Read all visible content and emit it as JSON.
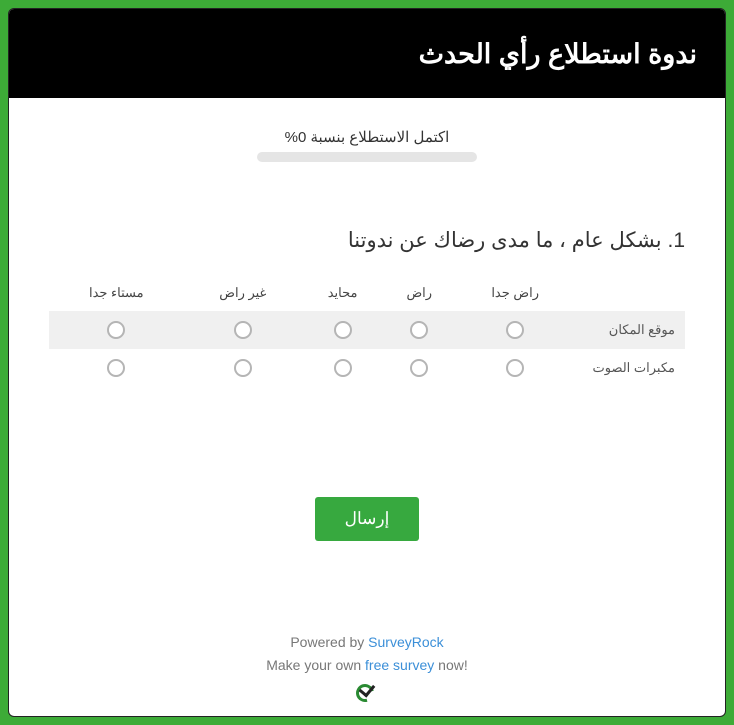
{
  "header": {
    "title": "ندوة استطلاع رأي الحدث"
  },
  "progress": {
    "text": "اكتمل الاستطلاع بنسبة 0%"
  },
  "question": {
    "title": "1. بشكل عام ، ما مدى رضاك عن ندوتنا",
    "scale": [
      "راض جدا",
      "راض",
      "محايد",
      "غير راض",
      "مستاء جدا"
    ],
    "rows": [
      "موقع المكان",
      "مكبرات الصوت"
    ]
  },
  "submit": {
    "label": "إرسال"
  },
  "footer": {
    "powered_prefix": "Powered by ",
    "powered_link": "SurveyRock",
    "make_prefix": "Make your own ",
    "make_link": "free survey",
    "make_suffix": " now!"
  }
}
